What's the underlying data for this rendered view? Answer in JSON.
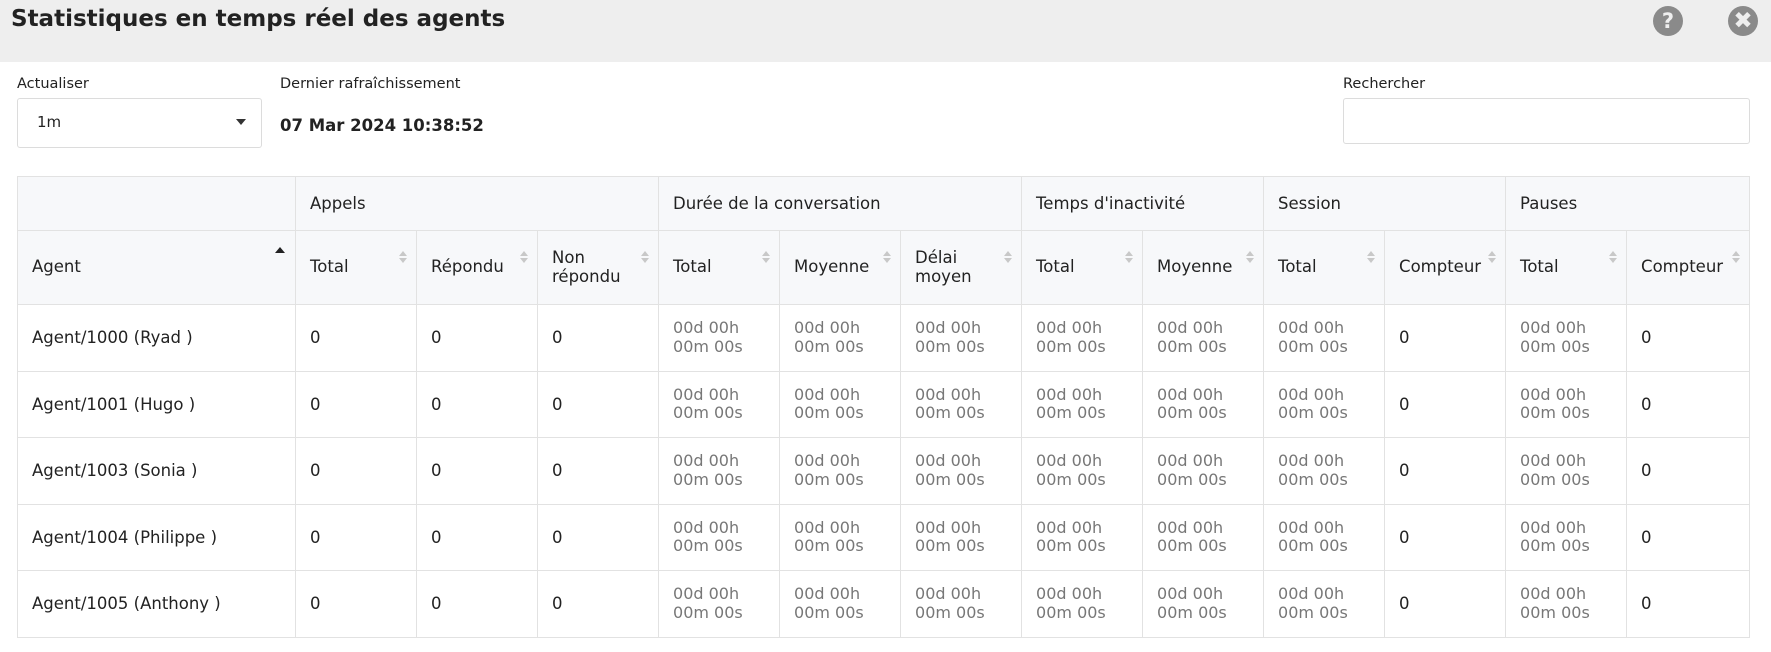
{
  "header": {
    "title": "Statistiques en temps réel des agents",
    "help_glyph": "?",
    "close_glyph": "✖"
  },
  "controls": {
    "refresh_label": "Actualiser",
    "refresh_value": "1m",
    "last_refresh_label": "Dernier rafraîchissement",
    "last_refresh_value": "07 Mar 2024 10:38:52",
    "search_label": "Rechercher",
    "search_value": ""
  },
  "table": {
    "groups": [
      "",
      "Appels",
      "Durée de la conversation",
      "Temps d'inactivité",
      "Session",
      "Pauses"
    ],
    "columns": [
      "Agent",
      "Total",
      "Répondu",
      "Non répondu",
      "Total",
      "Moyenne",
      "Délai moyen",
      "Total",
      "Moyenne",
      "Total",
      "Compteur",
      "Total",
      "Compteur"
    ],
    "rows": [
      [
        "Agent/1000 (Ryad )",
        "0",
        "0",
        "0",
        "00d 00h 00m 00s",
        "00d 00h 00m 00s",
        "00d 00h 00m 00s",
        "00d 00h 00m 00s",
        "00d 00h 00m 00s",
        "00d 00h 00m 00s",
        "0",
        "00d 00h 00m 00s",
        "0"
      ],
      [
        "Agent/1001 (Hugo )",
        "0",
        "0",
        "0",
        "00d 00h 00m 00s",
        "00d 00h 00m 00s",
        "00d 00h 00m 00s",
        "00d 00h 00m 00s",
        "00d 00h 00m 00s",
        "00d 00h 00m 00s",
        "0",
        "00d 00h 00m 00s",
        "0"
      ],
      [
        "Agent/1003 (Sonia )",
        "0",
        "0",
        "0",
        "00d 00h 00m 00s",
        "00d 00h 00m 00s",
        "00d 00h 00m 00s",
        "00d 00h 00m 00s",
        "00d 00h 00m 00s",
        "00d 00h 00m 00s",
        "0",
        "00d 00h 00m 00s",
        "0"
      ],
      [
        "Agent/1004 (Philippe )",
        "0",
        "0",
        "0",
        "00d 00h 00m 00s",
        "00d 00h 00m 00s",
        "00d 00h 00m 00s",
        "00d 00h 00m 00s",
        "00d 00h 00m 00s",
        "00d 00h 00m 00s",
        "0",
        "00d 00h 00m 00s",
        "0"
      ],
      [
        "Agent/1005 (Anthony )",
        "0",
        "0",
        "0",
        "00d 00h 00m 00s",
        "00d 00h 00m 00s",
        "00d 00h 00m 00s",
        "00d 00h 00m 00s",
        "00d 00h 00m 00s",
        "00d 00h 00m 00s",
        "0",
        "00d 00h 00m 00s",
        "0"
      ]
    ]
  }
}
